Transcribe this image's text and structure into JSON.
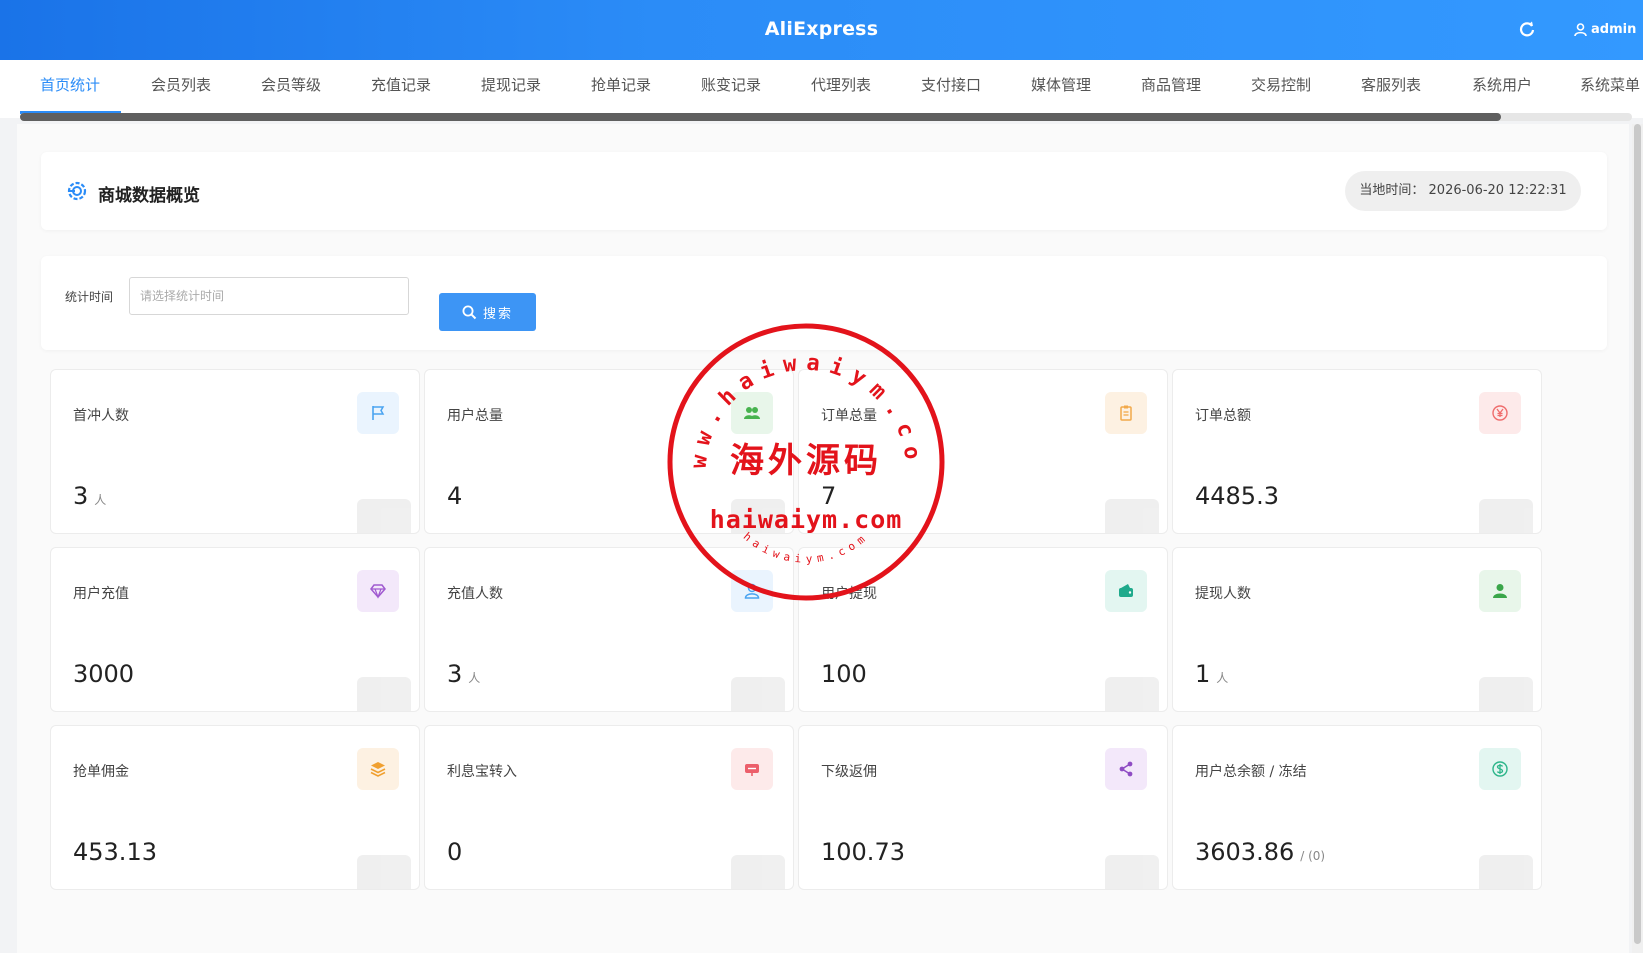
{
  "header": {
    "title": "AliExpress",
    "user": "admin"
  },
  "tabs": [
    "首页统计",
    "会员列表",
    "会员等级",
    "充值记录",
    "提现记录",
    "抢单记录",
    "账变记录",
    "代理列表",
    "支付接口",
    "媒体管理",
    "商品管理",
    "交易控制",
    "客服列表",
    "系统用户",
    "系统菜单"
  ],
  "active_tab": "首页统计",
  "overview": {
    "title": "商城数据概览",
    "time_label": "当地时间：",
    "time_value": "2026-06-20 12:22:31"
  },
  "filter": {
    "label": "统计时间",
    "placeholder": "请选择统计时间",
    "search_label": "搜索"
  },
  "cards": [
    {
      "label": "首冲人数",
      "value": "3",
      "unit": "人",
      "icon": "flag-icon",
      "color": "#4aa3f0",
      "bg": "#eaf4fe"
    },
    {
      "label": "用户总量",
      "value": "4",
      "unit": "",
      "icon": "users-icon",
      "color": "#47b34f",
      "bg": "#e8f6ea"
    },
    {
      "label": "订单总量",
      "value": "7",
      "unit": "",
      "icon": "clipboard-icon",
      "color": "#f2a94a",
      "bg": "#fdf1e2"
    },
    {
      "label": "订单总额",
      "value": "4485.3",
      "unit": "",
      "icon": "yen-icon",
      "color": "#ef6c6c",
      "bg": "#fdeaea"
    },
    {
      "label": "用户充值",
      "value": "3000",
      "unit": "",
      "icon": "diamond-icon",
      "color": "#a05ad0",
      "bg": "#f3e8fa"
    },
    {
      "label": "充值人数",
      "value": "3",
      "unit": "人",
      "icon": "user-outline-icon",
      "color": "#4aa3f0",
      "bg": "#eaf4fe"
    },
    {
      "label": "用户提现",
      "value": "100",
      "unit": "",
      "icon": "wallet-icon",
      "color": "#1faa8c",
      "bg": "#e3f6f1"
    },
    {
      "label": "提现人数",
      "value": "1",
      "unit": "人",
      "icon": "person-icon",
      "color": "#3aa64a",
      "bg": "#e8f6ea"
    },
    {
      "label": "抢单佣金",
      "value": "453.13",
      "unit": "",
      "icon": "layers-icon",
      "color": "#f0a030",
      "bg": "#fdf1e2"
    },
    {
      "label": "利息宝转入",
      "value": "0",
      "unit": "",
      "icon": "transfer-icon",
      "color": "#ec5f6b",
      "bg": "#fdeaea"
    },
    {
      "label": "下级返佣",
      "value": "100.73",
      "unit": "",
      "icon": "share-icon",
      "color": "#8f4cc4",
      "bg": "#f3e8fa"
    },
    {
      "label": "用户总余额 / 冻结",
      "value": "3603.86",
      "unit": "/ (0)",
      "icon": "dollar-icon",
      "color": "#2db58a",
      "bg": "#e3f6f1"
    }
  ],
  "watermark": {
    "brand": "haiwaiym.com",
    "arc_text": "www.haiwaiym.com",
    "chinese": "海外源码",
    "small": "haiwaiym.com"
  }
}
